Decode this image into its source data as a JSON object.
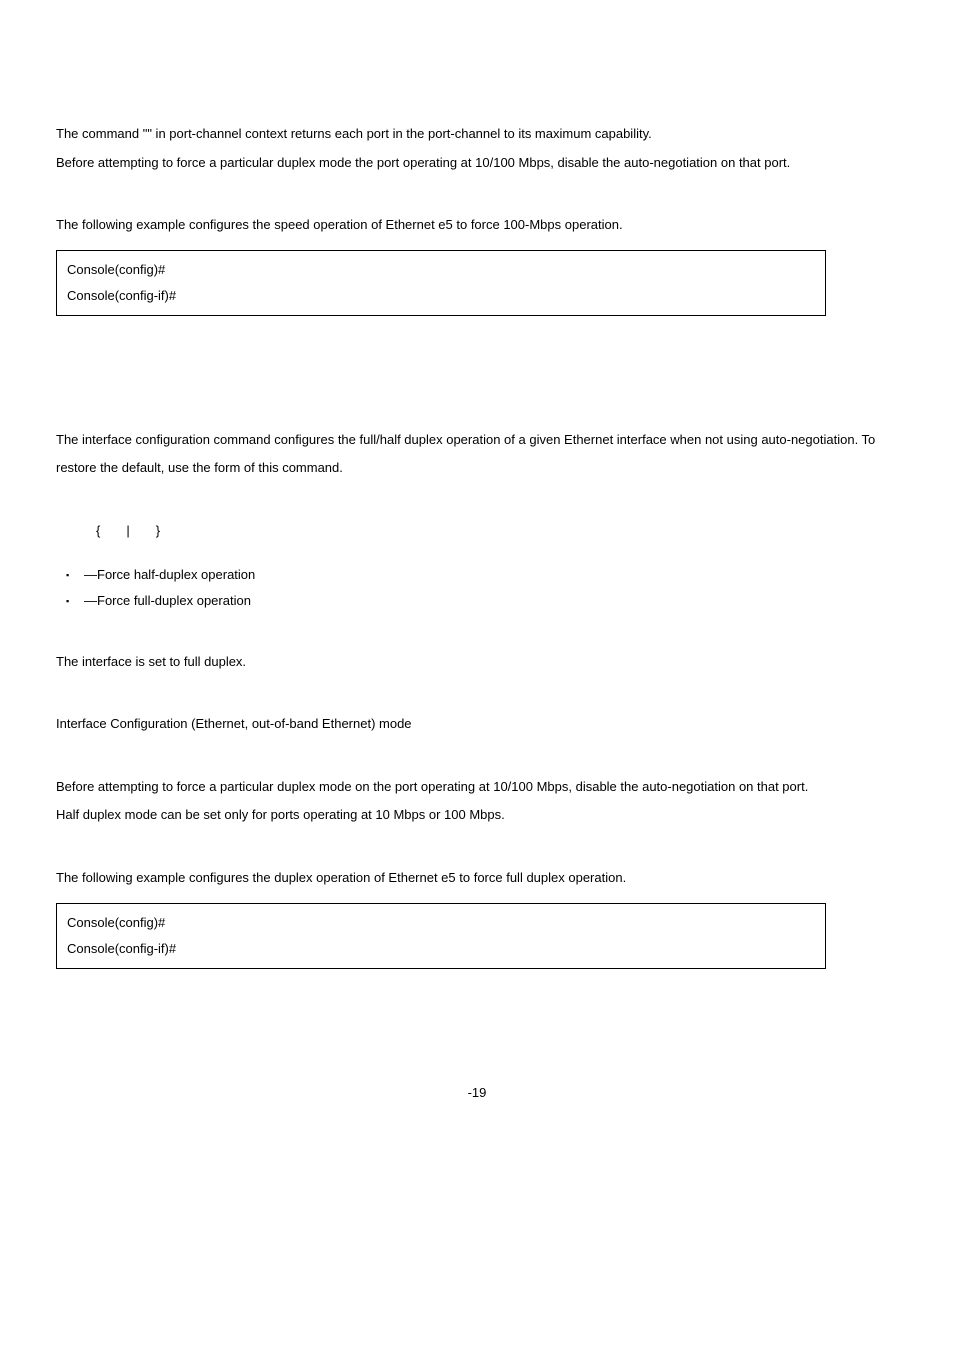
{
  "p1a": "The command \"",
  "p1b": "\" in port-channel context returns each port in the port-channel to its maximum capability.",
  "p2": "Before attempting to force a particular duplex mode the port operating at 10/100 Mbps, disable the auto-negotiation on that port.",
  "p3": "The following example configures the speed operation of Ethernet e5 to force 100-Mbps operation.",
  "code1_l1": "Console(config)#",
  "code1_l2": "Console(config-if)#",
  "p4a": "The ",
  "p4b": " interface configuration command configures the full/half duplex operation of a given Ethernet interface when not using auto-negotiation. To restore the default, use the ",
  "p4c": " form of this command.",
  "syntax": "{  |  }",
  "b1": "—Force half-duplex operation",
  "b2": "—Force full-duplex operation",
  "p5": "The interface is set to full duplex.",
  "p6": "Interface Configuration (Ethernet, out-of-band Ethernet) mode",
  "p7": "Before attempting to force a particular duplex mode on the port operating at 10/100 Mbps, disable the auto-negotiation on that port.",
  "p8": "Half duplex mode can be set only for ports operating at 10 Mbps or 100 Mbps.",
  "p9": "The following example configures the duplex operation of Ethernet e5 to force full duplex operation.",
  "code2_l1": "Console(config)#",
  "code2_l2": "Console(config-if)#",
  "footer": "-19"
}
